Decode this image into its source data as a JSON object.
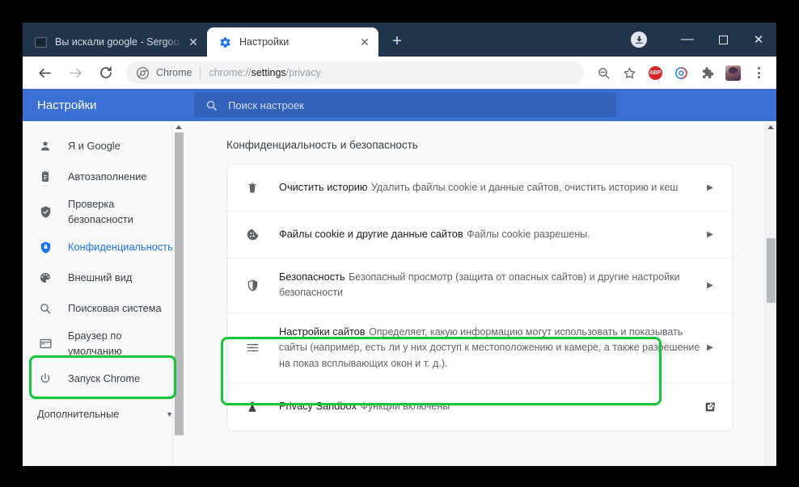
{
  "window": {
    "controls": {
      "download_icon": "download-circle-icon",
      "minimize_label": "—",
      "maximize_label": "□",
      "close_label": "✕"
    }
  },
  "tabstrip": {
    "tabs": [
      {
        "title": "Вы искали google - Sergoot.ru –",
        "favicon": "sg-favicon",
        "active": false,
        "close_label": "✕"
      },
      {
        "title": "Настройки",
        "favicon": "gear-icon",
        "active": true,
        "close_label": "✕"
      }
    ],
    "new_tab_label": "+"
  },
  "toolbar": {
    "back_icon": "arrow-left-icon",
    "forward_icon": "arrow-right-icon",
    "reload_icon": "reload-icon",
    "omnibox": {
      "site_icon": "chrome-logo-icon",
      "scheme_label": "Chrome",
      "url_prefix": "chrome://",
      "url_bold": "settings",
      "url_suffix": "/privacy"
    },
    "actions": [
      {
        "name": "zoom-out-icon",
        "label": ""
      },
      {
        "name": "bookmark-star-icon",
        "label": ""
      },
      {
        "name": "adblock-plus-icon",
        "label": "ABP"
      },
      {
        "name": "circle-extension-icon",
        "label": ""
      },
      {
        "name": "extensions-puzzle-icon",
        "label": ""
      },
      {
        "name": "profile-avatar-icon",
        "label": ""
      },
      {
        "name": "chrome-menu-icon",
        "label": ""
      }
    ]
  },
  "settings_header": {
    "title": "Настройки",
    "search_icon": "search-icon",
    "search_placeholder": "Поиск настроек",
    "search_value": ""
  },
  "sidebar": {
    "items": [
      {
        "label": "Я и Google",
        "icon": "person-icon",
        "active": false,
        "clipped": false
      },
      {
        "label": "Автозаполнение",
        "icon": "clipboard-icon",
        "active": false,
        "clipped": false
      },
      {
        "label": "Проверка безопасности",
        "icon": "shield-check-icon",
        "active": false,
        "clipped": false
      },
      {
        "label": "Конфиденциальность и безопасность",
        "icon": "shield-lock-icon",
        "active": true,
        "clipped": true
      },
      {
        "label": "Внешний вид",
        "icon": "palette-icon",
        "active": false,
        "clipped": false
      },
      {
        "label": "Поисковая система",
        "icon": "search-icon",
        "active": false,
        "clipped": false
      },
      {
        "label": "Браузер по умолчанию",
        "icon": "browser-window-icon",
        "active": false,
        "clipped": false
      },
      {
        "label": "Запуск Chrome",
        "icon": "power-icon",
        "active": false,
        "clipped": false
      }
    ],
    "advanced": {
      "label": "Дополнительные",
      "caret_icon": "chevron-down-icon"
    },
    "scrollbar": {
      "up_arrow": "scroll-up-arrow-icon"
    }
  },
  "main": {
    "heading": "Конфиденциальность и безопасность",
    "rows": [
      {
        "title": "Очистить историю",
        "subtitle": "Удалить файлы cookie и данные сайтов, очистить историю и кеш",
        "icon": "trash-icon",
        "trailing": "chevron-right-icon",
        "highlighted": false
      },
      {
        "title": "Файлы cookie и другие данные сайтов",
        "subtitle": "Файлы cookie разрешены.",
        "icon": "cookie-icon",
        "trailing": "chevron-right-icon",
        "highlighted": false
      },
      {
        "title": "Безопасность",
        "subtitle": "Безопасный просмотр (защита от опасных сайтов) и другие настройки безопасности",
        "icon": "shield-icon",
        "trailing": "chevron-right-icon",
        "highlighted": false
      },
      {
        "title": "Настройки сайтов",
        "subtitle": "Определяет, какую информацию могут использовать и показывать сайты (например, есть ли у них доступ к местоположению и камере, а также разрешение на показ всплывающих окон и т. д.).",
        "icon": "sliders-icon",
        "trailing": "chevron-right-icon",
        "highlighted": true
      },
      {
        "title": "Privacy Sandbox",
        "subtitle": "Функции включены",
        "icon": "flask-icon",
        "trailing": "external-link-icon",
        "highlighted": false
      }
    ],
    "scrollbar": {
      "up_arrow": "scroll-up-arrow-icon"
    }
  },
  "annotations": {
    "highlight_color": "#17c437",
    "sidebar_highlight_target": "Конфиденциальность и безопасность",
    "main_highlight_target": "Настройки сайтов"
  },
  "colors": {
    "tabstrip_bg": "#22344c",
    "settings_header_bg": "#3b6fd4",
    "settings_search_bg": "#3461bc",
    "accent_blue": "#1a73e8",
    "page_bg": "#f8f9fb"
  }
}
